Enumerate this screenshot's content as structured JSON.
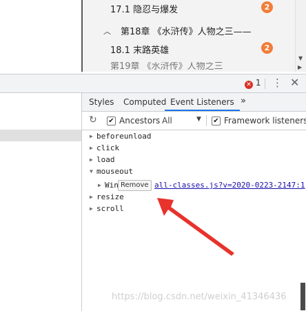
{
  "toc": {
    "items": [
      {
        "text": "17.1 隐忍与爆发",
        "badge": "2"
      },
      {
        "text": "第18章 《水浒传》人物之三——",
        "badge": ""
      },
      {
        "text": "18.1 末路英雄",
        "badge": "2"
      }
    ],
    "cut_text": "第19章 《水浒传》人物之三"
  },
  "devtools": {
    "error_count": "1",
    "error_icon": "✕",
    "menu_icon": "⋮",
    "close_icon": "✕",
    "tabs": [
      "Styles",
      "Computed",
      "Event Listeners",
      "»"
    ],
    "toolbar": {
      "ancestors_label": "Ancestors",
      "ancestors_checked": true,
      "filter_value": "All",
      "framework_label": "Framework listeners",
      "framework_checked": true
    },
    "events": [
      {
        "name": "beforeunload",
        "expanded": false
      },
      {
        "name": "click",
        "expanded": false
      },
      {
        "name": "load",
        "expanded": false
      },
      {
        "name": "mouseout",
        "expanded": true
      },
      {
        "name": "resize",
        "expanded": false
      },
      {
        "name": "scroll",
        "expanded": false
      }
    ],
    "listener": {
      "name": "Win",
      "remove_label": "Remove",
      "source": "all-classes.js?v=2020-0223-2147:1"
    }
  },
  "watermark": "https://blog.csdn.net/weixin_41346436",
  "colors": {
    "accent": "#1a73e8",
    "badge": "#f27d38",
    "arrow": "#e8322c",
    "error": "#d93025"
  }
}
